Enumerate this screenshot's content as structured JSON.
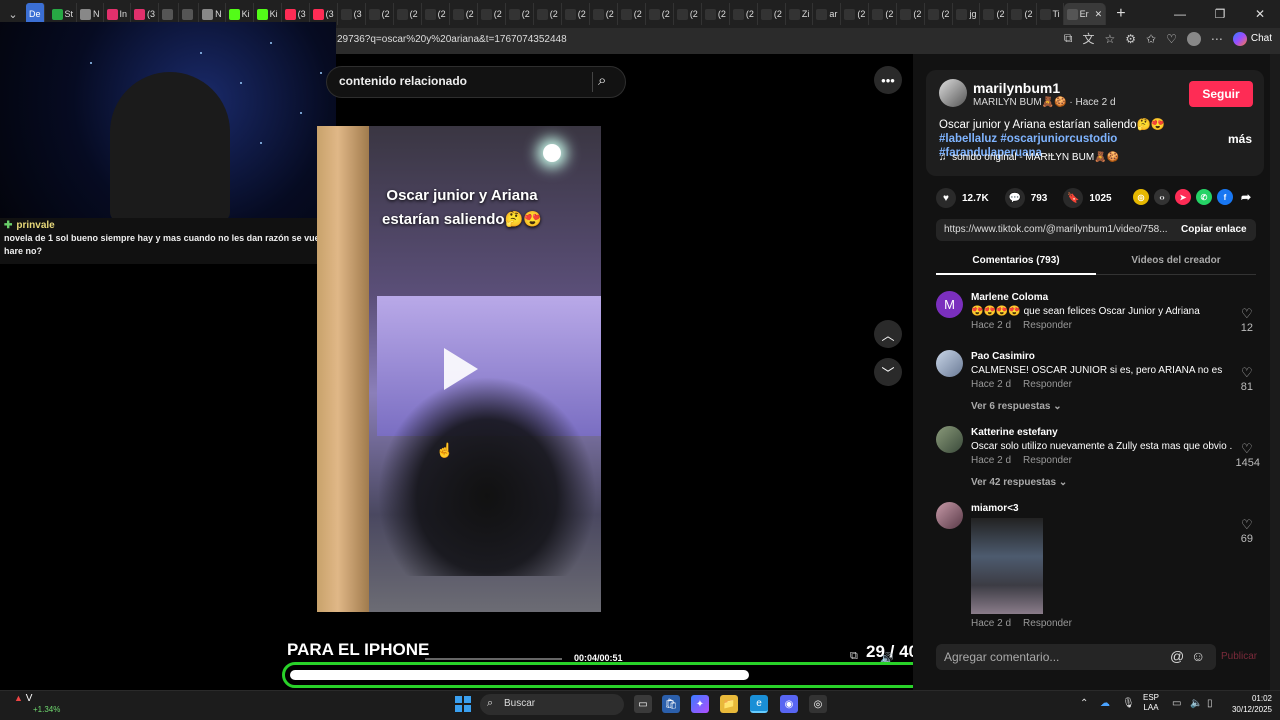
{
  "browser": {
    "workspace_label": "De",
    "mini_tabs": [
      {
        "label": "St",
        "color": "#27a844"
      },
      {
        "label": "N",
        "color": "#888"
      },
      {
        "label": "In",
        "color": "#e1306c"
      },
      {
        "label": "(3",
        "color": "#e1306c"
      },
      {
        "label": "",
        "color": "#555"
      },
      {
        "label": "",
        "color": "#555"
      },
      {
        "label": "N",
        "color": "#888"
      },
      {
        "label": "Ki",
        "color": "#53fc18"
      },
      {
        "label": "Ki",
        "color": "#53fc18"
      },
      {
        "label": "(3",
        "color": "#fe2c55"
      },
      {
        "label": "(3",
        "color": "#fe2c55"
      },
      {
        "label": "(3",
        "color": "#333"
      },
      {
        "label": "(2",
        "color": "#333"
      },
      {
        "label": "(2",
        "color": "#333"
      },
      {
        "label": "(2",
        "color": "#333"
      },
      {
        "label": "(2",
        "color": "#333"
      },
      {
        "label": "(2",
        "color": "#333"
      },
      {
        "label": "(2",
        "color": "#333"
      },
      {
        "label": "(2",
        "color": "#333"
      },
      {
        "label": "(2",
        "color": "#333"
      },
      {
        "label": "(2",
        "color": "#333"
      },
      {
        "label": "(2",
        "color": "#333"
      },
      {
        "label": "(2",
        "color": "#333"
      },
      {
        "label": "(2",
        "color": "#333"
      },
      {
        "label": "(2",
        "color": "#333"
      },
      {
        "label": "(2",
        "color": "#333"
      },
      {
        "label": "(2",
        "color": "#333"
      },
      {
        "label": "Zi",
        "color": "#333"
      },
      {
        "label": "ar",
        "color": "#333"
      },
      {
        "label": "(2",
        "color": "#333"
      },
      {
        "label": "(2",
        "color": "#333"
      },
      {
        "label": "(2",
        "color": "#333"
      },
      {
        "label": "(2",
        "color": "#333"
      },
      {
        "label": "jg",
        "color": "#333"
      },
      {
        "label": "(2",
        "color": "#333"
      },
      {
        "label": "(2",
        "color": "#333"
      },
      {
        "label": "Ti",
        "color": "#333"
      }
    ],
    "active_tab_label": "Er",
    "url": "29736?q=oscar%20y%20ariana&t=1767074352448",
    "chat_label": "Chat"
  },
  "pip_chat": {
    "username": "prinvale",
    "message": "novela de 1 sol bueno siempre hay y mas cuando no les dan razón se vuelven hare no?"
  },
  "search": {
    "text": "contenido relacionado"
  },
  "video": {
    "caption_line1": "Oscar junior y Ariana",
    "caption_line2": "estarían saliendo🤔😍",
    "overlay_text": "PARA EL IPHONE",
    "time": "00:04/00:51",
    "counter": "29 / 40",
    "progress": 0.72
  },
  "author": {
    "username": "marilynbum1",
    "display_name": "MARILYN BUM🧸🍪",
    "time_ago": "Hace 2 d",
    "follow_label": "Seguir",
    "description": "Oscar junior y Ariana estarían saliendo🤔😍",
    "hashtags": [
      "#labellaluz",
      "#oscarjuniorcustodio",
      "#farandulaperuana"
    ],
    "ellipsis": "...",
    "more_label": "más",
    "sound": "sonido original - MARILYN BUM🧸🍪"
  },
  "stats": {
    "likes": "12.7K",
    "comments": "793",
    "saves": "1025"
  },
  "link": {
    "url": "https://www.tiktok.com/@marilynbum1/video/758...",
    "copy_label": "Copiar enlace"
  },
  "tabs": {
    "comments": "Comentarios (793)",
    "creator_videos": "Videos del creador"
  },
  "comments": [
    {
      "name": "Marlene Coloma",
      "text": "😍😍😍😍 que sean felices Oscar Junior y Adriana",
      "time": "Hace 2 d",
      "reply": "Responder",
      "likes": "12",
      "replies": ""
    },
    {
      "name": "Pao Casimiro",
      "text": "CALMENSE! OSCAR JUNIOR si es, pero ARIANA no es",
      "time": "Hace 2 d",
      "reply": "Responder",
      "likes": "81",
      "replies": "Ver 6 respuestas"
    },
    {
      "name": "Katterine estefany",
      "text": "Oscar solo utilizo nuevamente a Zully esta mas que obvio .",
      "time": "Hace 2 d",
      "reply": "Responder",
      "likes": "1454",
      "replies": "Ver 42 respuestas"
    },
    {
      "name": "miamor<3",
      "text": "",
      "time": "Hace 2 d",
      "reply": "Responder",
      "likes": "69",
      "replies": ""
    }
  ],
  "comment_input": {
    "placeholder": "Agregar comentario...",
    "publish_label": "Publicar"
  },
  "taskbar": {
    "stock_name": "V",
    "stock_change": "+1.34%",
    "search_label": "Buscar",
    "lang_line1": "ESP",
    "lang_line2": "LAA",
    "time": "01:02",
    "date": "30/12/2025"
  }
}
